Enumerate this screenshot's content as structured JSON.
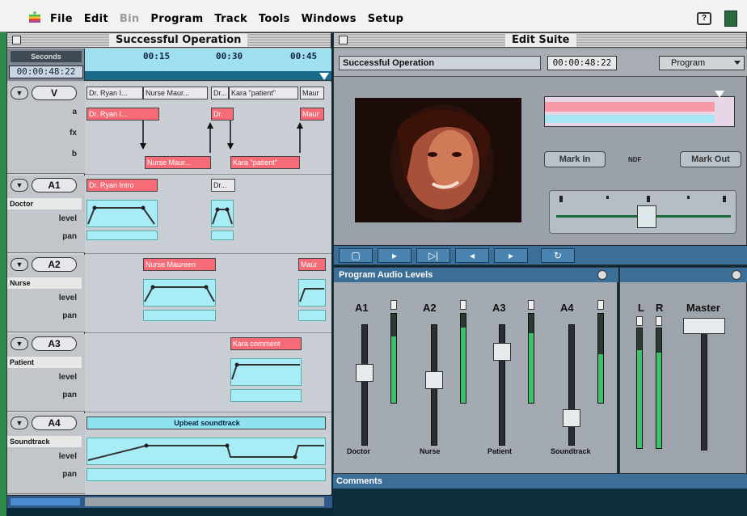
{
  "menubar": {
    "items": [
      "File",
      "Edit",
      "Bin",
      "Program",
      "Track",
      "Tools",
      "Windows",
      "Setup"
    ],
    "help_icon": "?"
  },
  "timeline": {
    "title": "Successful Operation",
    "seconds_label": "Seconds",
    "timecode": "00:00:48:22",
    "ruler_ticks": [
      "00:15",
      "00:30",
      "00:45"
    ],
    "video_track": {
      "name": "V",
      "sub_labels": [
        "a",
        "fx",
        "b"
      ],
      "clips_top": [
        "Dr. Ryan I...",
        "Nurse Maur...",
        "Dr...",
        "Kara \"patient\"",
        "Maur"
      ],
      "clips_a": [
        "Dr. Ryan I...",
        "Dr.",
        "Maur"
      ],
      "clips_b": [
        "Nurse Maur...",
        "Kara \"patient\""
      ]
    },
    "audio_tracks": [
      {
        "name": "A1",
        "label": "Doctor",
        "clips": [
          "Dr. Ryan Intro",
          "Dr..."
        ]
      },
      {
        "name": "A2",
        "label": "Nurse",
        "clips": [
          "Nurse Maureen",
          "Maur"
        ]
      },
      {
        "name": "A3",
        "label": "Patient",
        "clips": [
          "Kara comment"
        ]
      },
      {
        "name": "A4",
        "label": "Soundtrack",
        "clips": [
          "Upbeat soundtrack"
        ]
      }
    ],
    "level_label": "level",
    "pan_label": "pan"
  },
  "edit_suite": {
    "title": "Edit Suite",
    "clip_name": "Successful Operation",
    "timecode": "00:00:48:22",
    "source_select": "Program",
    "mark_in": "Mark In",
    "mark_out": "Mark Out",
    "ndf": "NDF"
  },
  "audio_levels": {
    "title": "Program Audio Levels",
    "channels": [
      {
        "id": "A1",
        "name": "Doctor",
        "fader": 0.62,
        "meter": 0.75
      },
      {
        "id": "A2",
        "name": "Nurse",
        "fader": 0.55,
        "meter": 0.85
      },
      {
        "id": "A3",
        "name": "Patient",
        "fader": 0.82,
        "meter": 0.78
      },
      {
        "id": "A4",
        "name": "Soundtrack",
        "fader": 0.18,
        "meter": 0.55
      }
    ],
    "master": {
      "left_label": "L",
      "right_label": "R",
      "title": "Master"
    }
  },
  "comments": {
    "title": "Comments"
  },
  "colors": {
    "video_clip_red": "#f56b78",
    "level_cyan": "#a8ecf6",
    "header_blue": "#3c6f98",
    "meter_green": "#3fc06a"
  }
}
